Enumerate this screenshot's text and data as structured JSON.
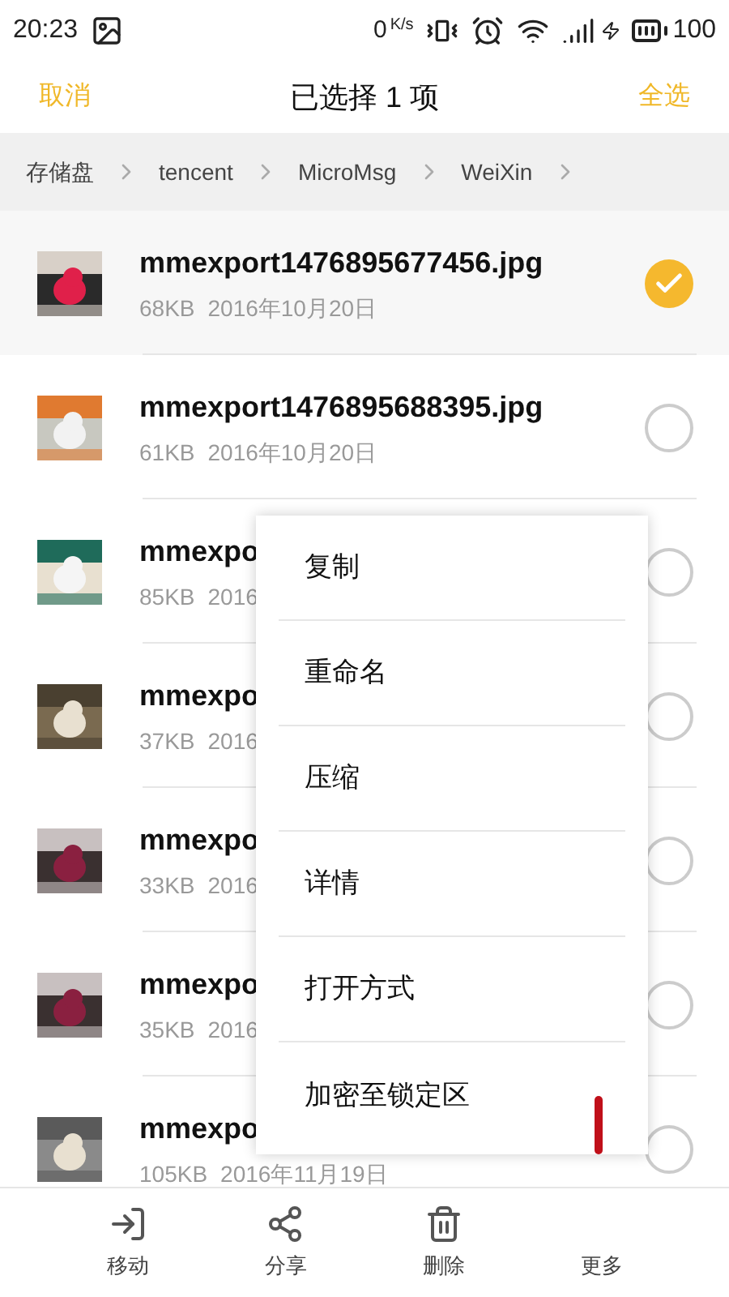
{
  "status_bar": {
    "time": "20:23",
    "net_speed": "0",
    "net_unit": "K/s",
    "battery": "100"
  },
  "header": {
    "cancel": "取消",
    "title": "已选择 1 项",
    "select_all": "全选"
  },
  "breadcrumb": [
    "存储盘",
    "tencent",
    "MicroMsg",
    "WeiXin"
  ],
  "files": [
    {
      "name": "mmexport1476895677456.jpg",
      "size": "68KB",
      "date": "2016年10月20日",
      "selected": true
    },
    {
      "name": "mmexport1476895688395.jpg",
      "size": "61KB",
      "date": "2016年10月20日",
      "selected": false
    },
    {
      "name": "mmexpo",
      "size": "85KB",
      "date": "2016",
      "selected": false
    },
    {
      "name": "mmexpo",
      "size": "37KB",
      "date": "2016",
      "selected": false
    },
    {
      "name": "mmexpo",
      "size": "33KB",
      "date": "2016",
      "selected": false
    },
    {
      "name": "mmexpo",
      "size": "35KB",
      "date": "2016",
      "selected": false
    },
    {
      "name": "mmexpo",
      "size": "105KB",
      "date": "2016年11月19日",
      "selected": false
    }
  ],
  "context_menu": [
    "复制",
    "重命名",
    "压缩",
    "详情",
    "打开方式",
    "加密至锁定区"
  ],
  "bottom_bar": [
    {
      "kind": "move",
      "label": "移动"
    },
    {
      "kind": "share",
      "label": "分享"
    },
    {
      "kind": "delete",
      "label": "删除"
    },
    {
      "kind": "more",
      "label": "更多"
    }
  ]
}
